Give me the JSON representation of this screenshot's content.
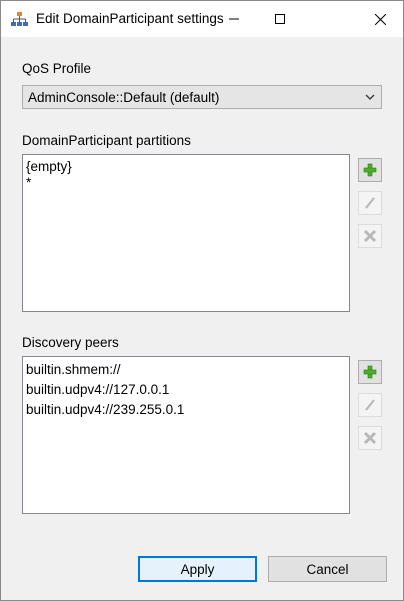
{
  "window": {
    "title": "Edit DomainParticipant settings"
  },
  "qos": {
    "label": "QoS Profile",
    "selected": "AdminConsole::Default (default)"
  },
  "partitions": {
    "label": "DomainParticipant partitions",
    "items": [
      "{empty}",
      "*"
    ]
  },
  "peers": {
    "label": "Discovery peers",
    "items": [
      "builtin.shmem://",
      "builtin.udpv4://127.0.0.1",
      "builtin.udpv4://239.255.0.1"
    ]
  },
  "buttons": {
    "apply": "Apply",
    "cancel": "Cancel"
  },
  "icons": {
    "app": "participant-tree-icon",
    "add": "plus-icon",
    "edit": "pencil-icon",
    "remove": "x-icon"
  },
  "colors": {
    "add_icon": "#4caf2a",
    "disabled_icon": "#b8b8b8",
    "default_button_border": "#0078d7"
  }
}
